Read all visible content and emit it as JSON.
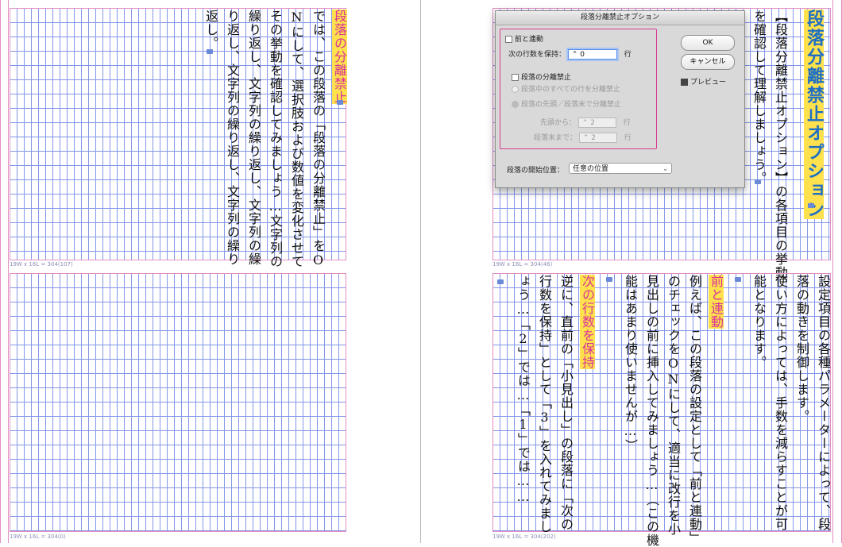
{
  "left_page": {
    "top_frame": {
      "grid_label": "19W x 16L = 304(107)",
      "columns": [
        {
          "text": "段落の分離禁止",
          "style": "magenta"
        },
        {
          "text": "では、この段落の「段落の分離禁止」をO"
        },
        {
          "text": "Nにして、選択肢および数値を変化させて"
        },
        {
          "text": "その挙動を確認してみましょう…文字列の"
        },
        {
          "text": "繰り返し、文字列の繰り返し、文字列の繰"
        },
        {
          "text": "り返し、文字列の繰り返し、文字列の繰り"
        },
        {
          "text": "返し。"
        }
      ]
    },
    "bottom_frame": {
      "grid_label": "19W x 16L = 304(0)"
    }
  },
  "right_page": {
    "top_frame": {
      "grid_label": "19W x 16L = 304(46)",
      "heading": "段落分離禁止オプション",
      "columns": [
        {
          "text": "【段落分離禁止オプション】の各項目の挙動"
        },
        {
          "text": "を確認して理解しましょう。"
        }
      ]
    },
    "bottom_frame": {
      "grid_label": "19W x 16L = 304(202)",
      "columns": [
        {
          "text": "設定項目の各種パラメーターによって、段"
        },
        {
          "text": "落の動きを制御します。"
        },
        {
          "text": "使い方によっては、手数を減らすことが可"
        },
        {
          "text": "能となります。"
        },
        {
          "text": ""
        },
        {
          "text": "前と連動",
          "style": "magenta"
        },
        {
          "text": "例えば、この段落の設定として「前と連動」"
        },
        {
          "text": "のチェックをONにして、適当に改行を小"
        },
        {
          "text": "見出しの前に挿入してみましょう…（この機"
        },
        {
          "text": "能はあまり使いませんが…）"
        },
        {
          "text": ""
        },
        {
          "text": "次の行数を保持",
          "style": "magenta"
        },
        {
          "text": "逆に、直前の「小見出し」の段落に「次の"
        },
        {
          "text": "行数を保持」として「3」を入れてみまし"
        },
        {
          "text": "ょう…「2」では…「1」では……"
        }
      ]
    }
  },
  "dialog": {
    "title": "段落分離禁止オプション",
    "keep_with_previous": "前と連動",
    "keep_with_next_label": "次の行数を保持：",
    "keep_with_next_value": "0",
    "line_unit": "行",
    "keep_lines_together": "段落の分離禁止",
    "all_lines": "段落中のすべての行を分離禁止",
    "start_end": "段落の先頭／段落末で分離禁止",
    "start_label": "先頭から：",
    "start_value": "2",
    "end_label": "段落末まで：",
    "end_value": "2",
    "ok": "OK",
    "cancel": "キャンセル",
    "preview": "プレビュー",
    "start_position_label": "段落の開始位置：",
    "start_position_value": "任意の位置"
  }
}
